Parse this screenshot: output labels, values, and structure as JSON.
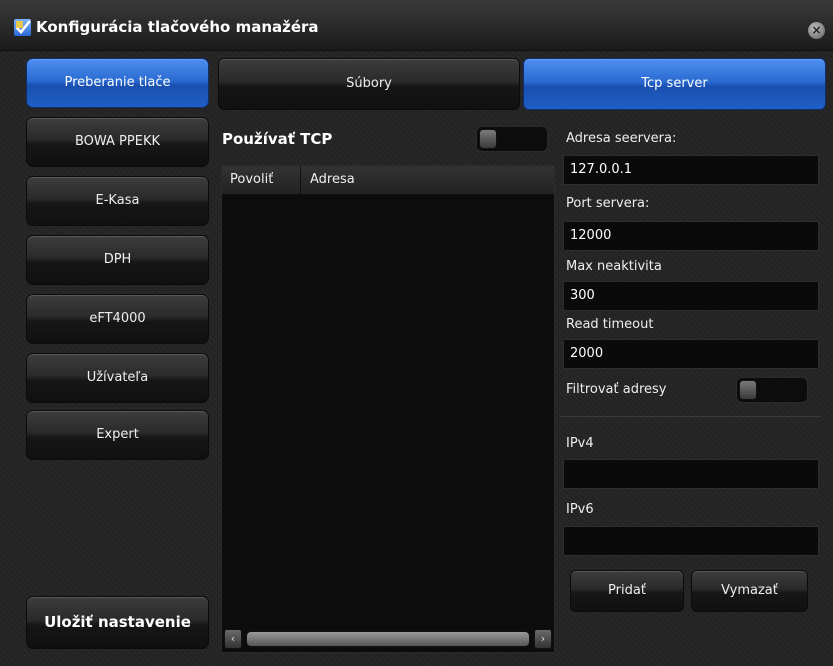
{
  "window": {
    "title": "Konfigurácia tlačového manažéra",
    "icon": "checkmark-app-icon",
    "close_glyph": "×"
  },
  "sidebar": {
    "items": [
      {
        "label": "Preberanie tlače",
        "active": true
      },
      {
        "label": "BOWA PPEKK",
        "active": false
      },
      {
        "label": "E-Kasa",
        "active": false
      },
      {
        "label": "DPH",
        "active": false
      },
      {
        "label": "eFT4000",
        "active": false
      },
      {
        "label": "Užívateľa",
        "active": false
      },
      {
        "label": "Expert",
        "active": false
      }
    ],
    "save_label": "Uložiť nastavenie"
  },
  "tabs": [
    {
      "label": "Súbory",
      "active": false
    },
    {
      "label": "Tcp server",
      "active": true
    }
  ],
  "tcp": {
    "use_label": "Používať TCP",
    "use_enabled": false,
    "list": {
      "columns": [
        "Povoliť",
        "Adresa"
      ],
      "rows": []
    },
    "scroll_left_glyph": "‹",
    "scroll_right_glyph": "›"
  },
  "server": {
    "address_label": "Adresa seervera:",
    "address_value": "127.0.0.1",
    "port_label": "Port servera:",
    "port_value": "12000",
    "max_inactivity_label": "Max neaktivita",
    "max_inactivity_value": "300",
    "read_timeout_label": "Read timeout",
    "read_timeout_value": "2000",
    "filter_label": "Filtrovať adresy",
    "filter_enabled": false,
    "ipv4_label": "IPv4",
    "ipv4_value": "",
    "ipv6_label": "IPv6",
    "ipv6_value": "",
    "add_label": "Pridať",
    "delete_label": "Vymazať"
  },
  "colors": {
    "accent": "#2a6bd2",
    "background": "#232323",
    "field_bg": "#0a0a0a"
  }
}
